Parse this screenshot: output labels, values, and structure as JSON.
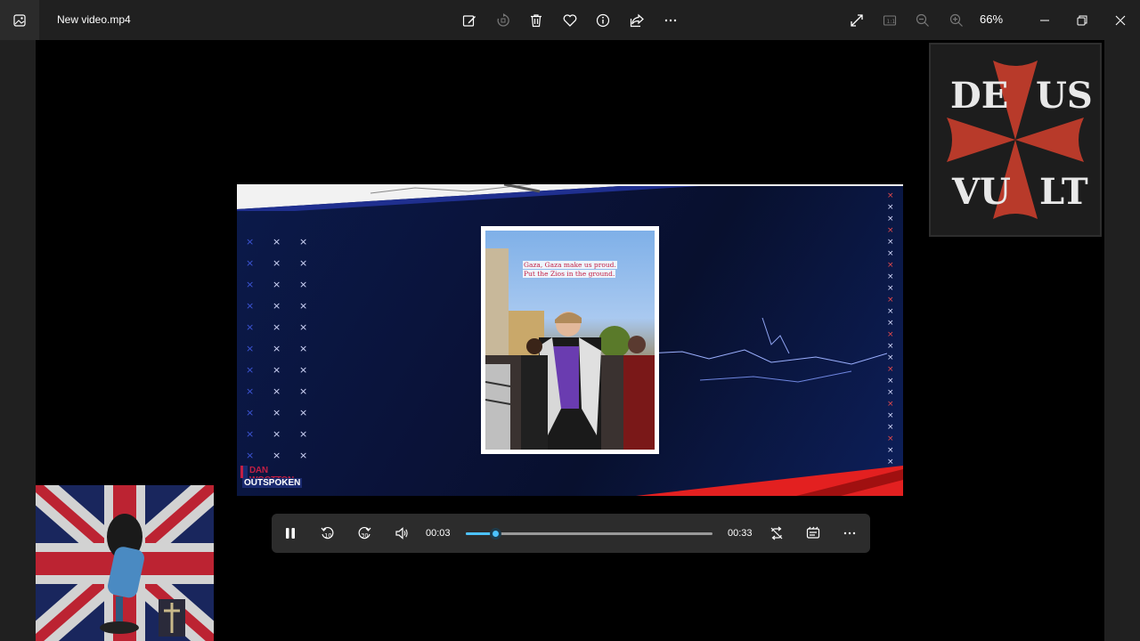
{
  "window": {
    "file_name": "New video.mp4",
    "zoom": "66%"
  },
  "toolbar": {
    "icons": [
      "edit-image-icon",
      "rotate-icon",
      "delete-icon",
      "favorite-icon",
      "info-icon",
      "share-icon",
      "more-icon"
    ],
    "view_icons": [
      "full-screen-icon",
      "actual-size-icon",
      "zoom-out-icon",
      "zoom-in-icon"
    ]
  },
  "video": {
    "caption_line1": "Gaza, Gaza make us proud.",
    "caption_line2": "Put the Zios in the ground.",
    "show_name": "DAN WOOTTON",
    "show_sub": "OUTSPOKEN"
  },
  "patch": {
    "top_left": "DE",
    "top_right": "US",
    "bottom_left": "VU",
    "bottom_right": "LT",
    "cross_color": "#b83a2a"
  },
  "player": {
    "current_time": "00:03",
    "total_time": "00:33",
    "progress": 0.12,
    "accent": "#4cc2ff",
    "skip_back_label": "10",
    "skip_forward_label": "30"
  }
}
